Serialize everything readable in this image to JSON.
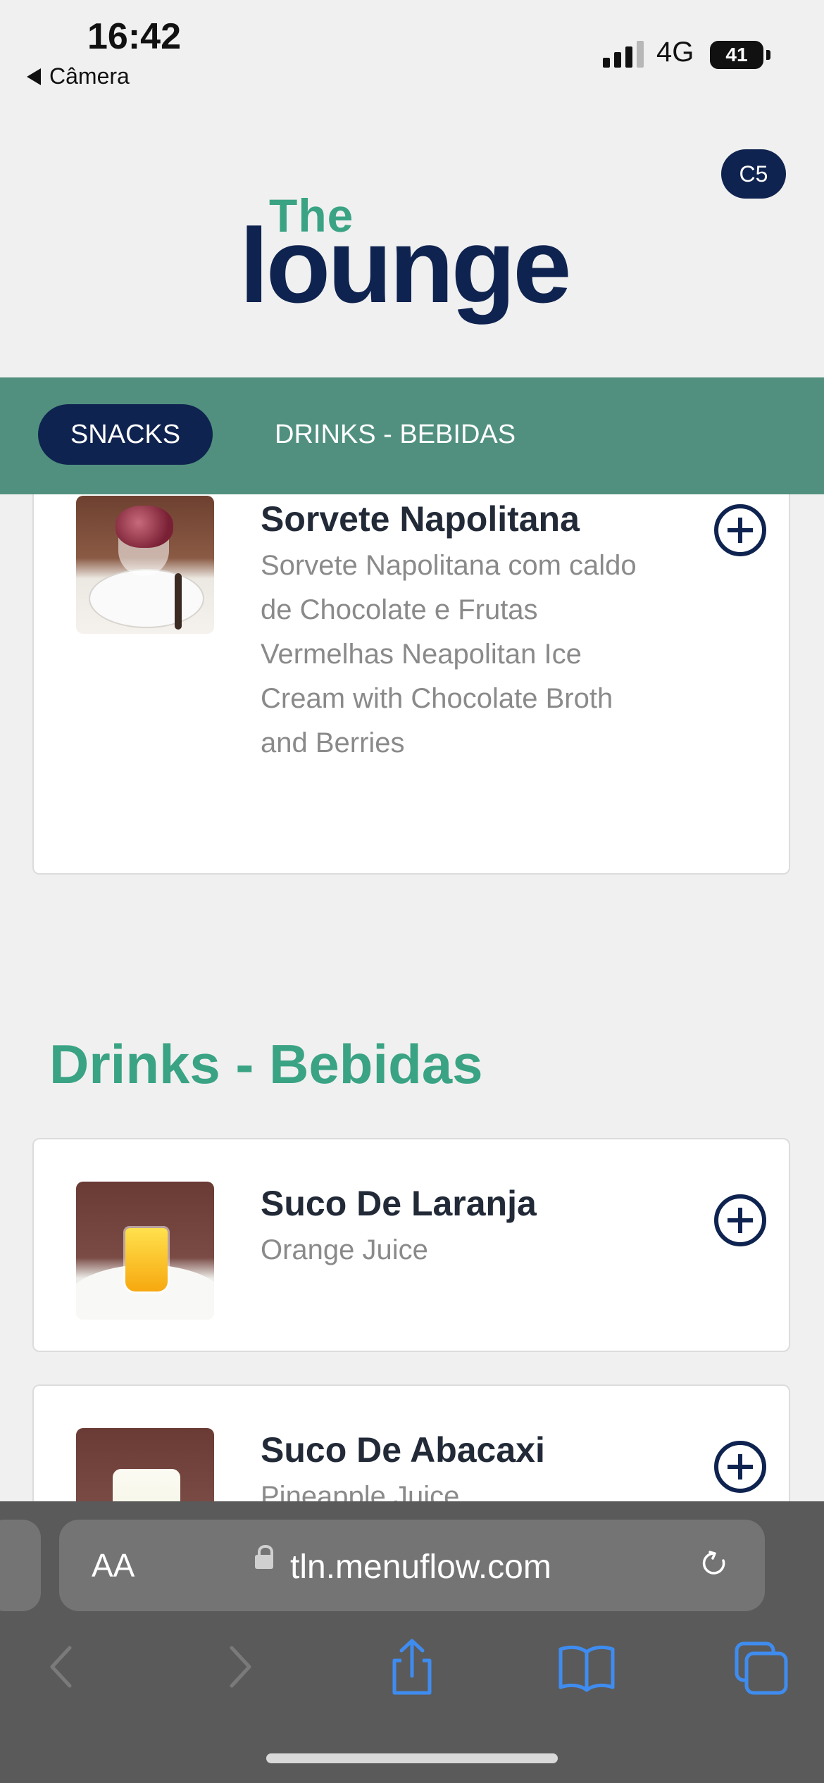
{
  "status_bar": {
    "time": "16:42",
    "back_app": "Câmera",
    "network": "4G",
    "battery": "41"
  },
  "header": {
    "logo_top": "The",
    "logo_bottom": "lounge",
    "table_code": "C5"
  },
  "category_tabs": [
    {
      "label": "SNACKS",
      "active": true
    },
    {
      "label": "DRINKS - BEBIDAS",
      "active": false
    }
  ],
  "snacks_items": [
    {
      "name": "Sorvete Napolitana",
      "description": "Sorvete Napolitana com caldo de Chocolate e Frutas Vermelhas Neapolitan Ice Cream with Chocolate Broth and Berries",
      "image": "ice-cream-photo"
    }
  ],
  "drinks_section": {
    "title": "Drinks - Bebidas",
    "items": [
      {
        "name": "Suco De Laranja",
        "description": "Orange Juice",
        "image": "orange-juice-photo"
      },
      {
        "name": "Suco De Abacaxi",
        "description": "Pineapple Juice",
        "image": "pineapple-juice-photo"
      }
    ]
  },
  "browser": {
    "text_size_label": "AA",
    "url": "tln.menuflow.com",
    "icons": [
      "back-icon",
      "forward-icon",
      "share-icon",
      "bookmarks-icon",
      "tabs-icon",
      "reload-icon",
      "lock-icon"
    ]
  },
  "colors": {
    "navy": "#0f2350",
    "green_accent": "#3aa383",
    "nav_bar": "#51907f"
  }
}
